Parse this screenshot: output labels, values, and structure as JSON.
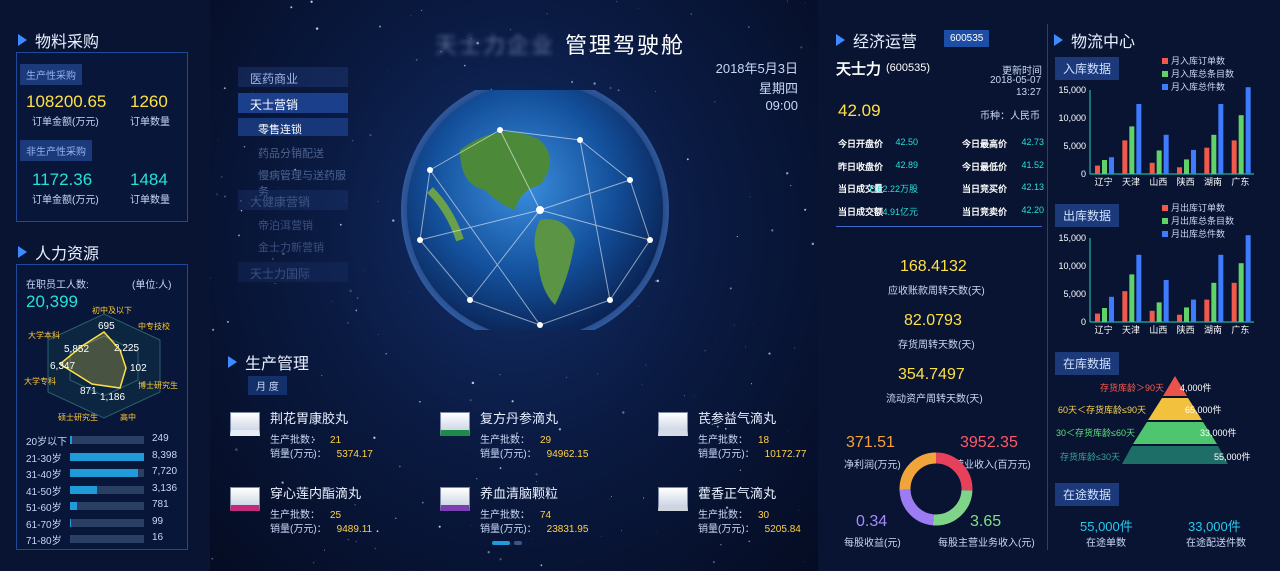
{
  "procurement": {
    "title": "物料采购",
    "production_tag": "生产性采购",
    "production_amount": "108200.65",
    "production_amount_label": "订单金额(万元)",
    "production_count": "1260",
    "production_count_label": "订单数量",
    "nonproduction_tag": "非生产性采购",
    "nonproduction_amount": "1172.36",
    "nonproduction_amount_label": "订单金额(万元)",
    "nonproduction_count": "1484",
    "nonproduction_count_label": "订单数量"
  },
  "hr": {
    "title": "人力资源",
    "headcount_label": "在职员工人数:",
    "unit": "(单位:人)",
    "headcount": "20,399",
    "radar": {
      "labels": [
        "初中及以下",
        "中专技校",
        "博士研究生",
        "高中",
        "硕士研究生",
        "大学专科",
        "大学本科"
      ],
      "values": [
        "695",
        "2,225",
        "102",
        "1,186",
        "871",
        "6,347",
        "5,852"
      ]
    },
    "age_bars": [
      {
        "label": "20岁以下",
        "value": "249",
        "fraction": 0.03
      },
      {
        "label": "21-30岁",
        "value": "8,398",
        "fraction": 1.0
      },
      {
        "label": "31-40岁",
        "value": "7,720",
        "fraction": 0.92
      },
      {
        "label": "41-50岁",
        "value": "3,136",
        "fraction": 0.37
      },
      {
        "label": "51-60岁",
        "value": "781",
        "fraction": 0.09
      },
      {
        "label": "61-70岁",
        "value": "99",
        "fraction": 0.01
      },
      {
        "label": "71-80岁",
        "value": "16",
        "fraction": 0.0
      }
    ]
  },
  "cockpit": {
    "title_blur": "天士力企业",
    "title": "管理驾驶舱",
    "date": "2018年5月3日",
    "weekday": "星期四",
    "time": "09:00",
    "menu": [
      "医药商业",
      "天士营销",
      "零售连锁",
      "药品分销配送",
      "慢病管理与送药服务",
      "大健康营销",
      "帝泊洱营销",
      "金士力新营销",
      "天士力国际"
    ]
  },
  "production": {
    "title": "生产管理",
    "period": "月 度",
    "batch_label": "生产批数：",
    "sales_label": "销量(万元)：",
    "drugs": [
      {
        "name": "荆花胃康胶丸",
        "batch": "21",
        "sales": "5374.17"
      },
      {
        "name": "复方丹参滴丸",
        "batch": "29",
        "sales": "94962.15"
      },
      {
        "name": "芪参益气滴丸",
        "batch": "18",
        "sales": "10172.77"
      },
      {
        "name": "穿心莲内酯滴丸",
        "batch": "25",
        "sales": "9489.11"
      },
      {
        "name": "养血清脑颗粒",
        "batch": "74",
        "sales": "23831.95"
      },
      {
        "name": "藿香正气滴丸",
        "batch": "30",
        "sales": "5205.84"
      }
    ]
  },
  "economy": {
    "title": "经济运营",
    "code_badge": "600535",
    "company": "天士力",
    "company_code": "(600535)",
    "update_label": "更新时间",
    "update_date": "2018-05-07",
    "update_time": "13:27",
    "price": "42.09",
    "currency": "币种：人民币",
    "quotes": [
      {
        "label": "今日开盘价",
        "value": "42.50"
      },
      {
        "label": "今日最高价",
        "value": "42.73"
      },
      {
        "label": "昨日收盘价",
        "value": "42.89"
      },
      {
        "label": "今日最低价",
        "value": "41.52"
      },
      {
        "label": "当日成交量",
        "value": "1162.22万股"
      },
      {
        "label": "当日竞买价",
        "value": "42.13"
      },
      {
        "label": "当日成交额",
        "value": "4.91亿元"
      },
      {
        "label": "当日竞卖价",
        "value": "42.20"
      }
    ],
    "metrics": [
      {
        "value": "168.4132",
        "label": "应收账款周转天数(天)"
      },
      {
        "value": "82.0793",
        "label": "存货周转天数(天)"
      },
      {
        "value": "354.7497",
        "label": "流动资产周转天数(天)"
      }
    ],
    "net_profit": "371.51",
    "net_profit_label": "净利润(万元)",
    "revenue": "3952.35",
    "revenue_label": "营业收入(百万元)",
    "eps": "0.34",
    "eps_label": "每股收益(元)",
    "main_rev_per_share": "3.65",
    "main_rev_per_share_label": "每股主营业务收入(元)"
  },
  "logistics": {
    "title": "物流中心",
    "inbound_tag": "入库数据",
    "outbound_tag": "出库数据",
    "stock_tag": "在库数据",
    "transit_tag": "在途数据",
    "inbound_legend": [
      "月入库订单数",
      "月入库总条目数",
      "月入库总件数"
    ],
    "outbound_legend": [
      "月出库订单数",
      "月出库总条目数",
      "月出库总件数"
    ],
    "colors": [
      "#ef5a4a",
      "#5fd36a",
      "#3d7bff"
    ],
    "stock_levels": [
      {
        "label": "存货库龄＞90天",
        "value": "4,000件"
      },
      {
        "label": "60天＜存货库龄≤90天",
        "value": "65,000件"
      },
      {
        "label": "30＜存货库龄≤60天",
        "value": "33,000件"
      },
      {
        "label": "存货库龄≤30天",
        "value": "55,000件"
      }
    ],
    "transit_orders": "55,000件",
    "transit_orders_label": "在途单数",
    "transit_items": "33,000件",
    "transit_items_label": "在途配送件数"
  },
  "chart_data": [
    {
      "type": "bar",
      "title": "入库数据",
      "categories": [
        "辽宁",
        "天津",
        "山西",
        "陕西",
        "湖南",
        "广东"
      ],
      "yticks": [
        "15,000",
        "10,000",
        "5,000",
        "0"
      ],
      "ylim": [
        0,
        15000
      ],
      "series": [
        {
          "name": "月入库订单数",
          "values": [
            1500,
            6000,
            2000,
            1200,
            4700,
            6000
          ]
        },
        {
          "name": "月入库总条目数",
          "values": [
            2500,
            8500,
            4200,
            2600,
            7000,
            10500
          ]
        },
        {
          "name": "月入库总件数",
          "values": [
            3000,
            12500,
            7000,
            4300,
            12500,
            15500
          ]
        }
      ]
    },
    {
      "type": "bar",
      "title": "出库数据",
      "categories": [
        "辽宁",
        "天津",
        "山西",
        "陕西",
        "湖南",
        "广东"
      ],
      "yticks": [
        "15,000",
        "10,000",
        "5,000",
        "0"
      ],
      "ylim": [
        0,
        15000
      ],
      "series": [
        {
          "name": "月出库订单数",
          "values": [
            1500,
            5500,
            2000,
            1300,
            4000,
            7000
          ]
        },
        {
          "name": "月出库总条目数",
          "values": [
            2500,
            8500,
            3500,
            2600,
            7000,
            10500
          ]
        },
        {
          "name": "月出库总件数",
          "values": [
            4500,
            12000,
            7500,
            4000,
            12000,
            15500
          ]
        }
      ]
    }
  ]
}
